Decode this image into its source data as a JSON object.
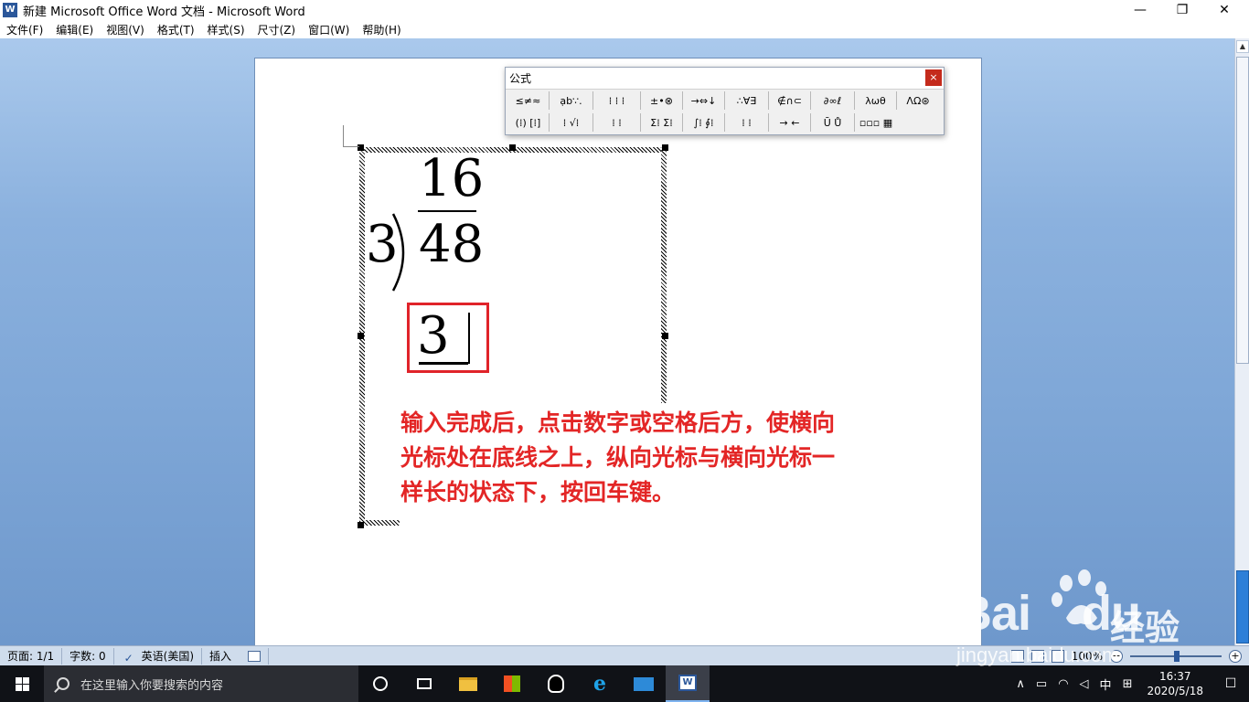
{
  "window": {
    "title": "新建 Microsoft Office Word 文档 - Microsoft Word",
    "app_icon": "W",
    "controls": {
      "minimize": "—",
      "maximize": "❐",
      "close": "✕"
    }
  },
  "menu": {
    "items": [
      "文件(F)",
      "编辑(E)",
      "视图(V)",
      "格式(T)",
      "样式(S)",
      "尺寸(Z)",
      "窗口(W)",
      "帮助(H)"
    ]
  },
  "equation": {
    "quotient": "16",
    "divisor": "3",
    "dividend": "48",
    "current_step": "3"
  },
  "annotation": {
    "lines": [
      "输入完成后，点击数字或空格后方，使横向",
      "光标处在底线之上，纵向光标与横向光标一",
      "样长的状态下，按回车键。"
    ],
    "color": "#e32626"
  },
  "formula_toolbar": {
    "title": "公式",
    "close": "×",
    "row1": [
      "≤≠≈",
      "ạb∵.",
      "⁞ ⁞ ⁞",
      "±•⊗",
      "→⇔↓",
      "∴∀∃",
      "∉∩⊂",
      "∂∞ℓ",
      "λωθ",
      "ΛΩ⊛"
    ],
    "row2": [
      "(⁞) [⁞]",
      "⁞ √⁞",
      "⁞ ⁞",
      "Σ⁞ Σ⁞",
      "∫⁞ ∮⁞",
      "⁞ ⁞",
      "→ ←",
      "Ū Ů",
      "▫▫▫ ▦"
    ]
  },
  "statusbar": {
    "page": "页面: 1/1",
    "words": "字数: 0",
    "language": "英语(美国)",
    "mode": "插入",
    "zoom": "100%",
    "zoom_out": "−",
    "zoom_in": "+"
  },
  "taskbar": {
    "search_placeholder": "在这里输入你要搜索的内容",
    "ie_glyph": "e",
    "word_glyph": "W",
    "tray_ime": "中",
    "tray_grid": "⊞",
    "time": "16:37",
    "date": "2020/5/18",
    "notification_glyph": "☐",
    "chevron": "∧"
  },
  "watermark": {
    "brand": "Bai",
    "brand2": "du",
    "jing": "经验",
    "url": "jingyan.baidu.com"
  },
  "colors": {
    "workspace": "#8bb1de",
    "highlight_box": "#e0232a",
    "taskbar": "#101217"
  }
}
